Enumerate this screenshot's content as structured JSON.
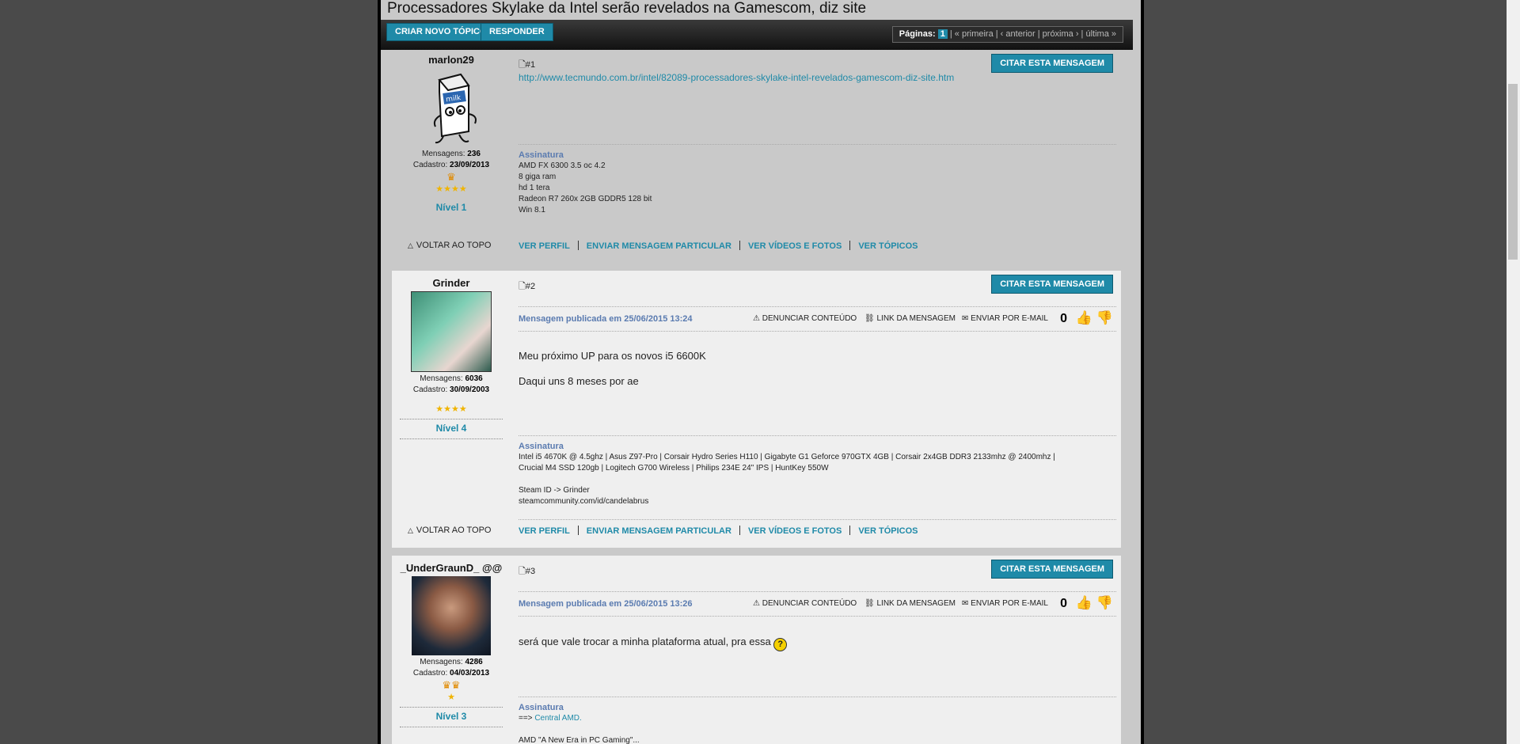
{
  "title": "Processadores Skylake da Intel serão revelados na Gamescom, diz site",
  "toolbar": {
    "new_topic": "CRIAR NOVO TÓPICO",
    "reply": "RESPONDER",
    "pager_label": "Páginas:",
    "pager_current": "1",
    "pager_rest": "| « primeira | ‹ anterior | próxima › | última »"
  },
  "common": {
    "quote": "CITAR ESTA MENSAGEM",
    "back_top": "VOLTAR AO TOPO",
    "report": "DENUNCIAR CONTEÚDO",
    "link_msg": "LINK DA MENSAGEM",
    "email": "ENVIAR POR E-MAIL",
    "sig_title": "Assinatura",
    "messages_label": "Mensagens:",
    "joined_label": "Cadastro:",
    "view_profile": "VER PERFIL",
    "send_pm": "ENVIAR MENSAGEM PARTICULAR",
    "videos_photos": "VER VÍDEOS E FOTOS",
    "topics": "VER TÓPICOS"
  },
  "posts": [
    {
      "username": "marlon29",
      "messages": "236",
      "joined": "23/09/2013",
      "level": "Nível 1",
      "number": "#1",
      "body_link": "http://www.tecmundo.com.br/intel/82089-processadores-skylake-intel-revelados-gamescom-diz-site.htm",
      "signature": [
        "AMD FX 6300 3.5 oc 4.2",
        "8 giga ram",
        "hd 1 tera",
        "Radeon R7 260x 2GB GDDR5 128 bit",
        "Win 8.1"
      ]
    },
    {
      "username": "Grinder",
      "messages": "6036",
      "joined": "30/09/2003",
      "level": "Nível 4",
      "number": "#2",
      "published": "Mensagem publicada em 25/06/2015 13:24",
      "votes": "0",
      "body": [
        "Meu próximo UP para os novos i5 6600K",
        "Daqui uns 8 meses por ae"
      ],
      "signature": [
        "Intel i5 4670K @ 4.5ghz | Asus Z97-Pro | Corsair Hydro Series H110 | Gigabyte G1 Geforce 970GTX 4GB | Corsair 2x4GB DDR3 2133mhz @ 2400mhz |",
        "Crucial M4 SSD 120gb | Logitech G700 Wireless | Philips 234E 24\" IPS | HuntKey 550W",
        "",
        "Steam ID -> Grinder",
        "steamcommunity.com/id/candelabrus"
      ]
    },
    {
      "username": "_UnderGraunD_ @@",
      "messages": "4286",
      "joined": "04/03/2013",
      "level": "Nível 3",
      "number": "#3",
      "published": "Mensagem publicada em 25/06/2015 13:26",
      "votes": "0",
      "body": [
        "será que vale trocar a minha plataforma atual, pra essa"
      ],
      "signature_prefix": "==>",
      "signature_link": "Central AMD.",
      "signature_extra": "AMD \"A New Era in PC Gaming\"..."
    }
  ]
}
